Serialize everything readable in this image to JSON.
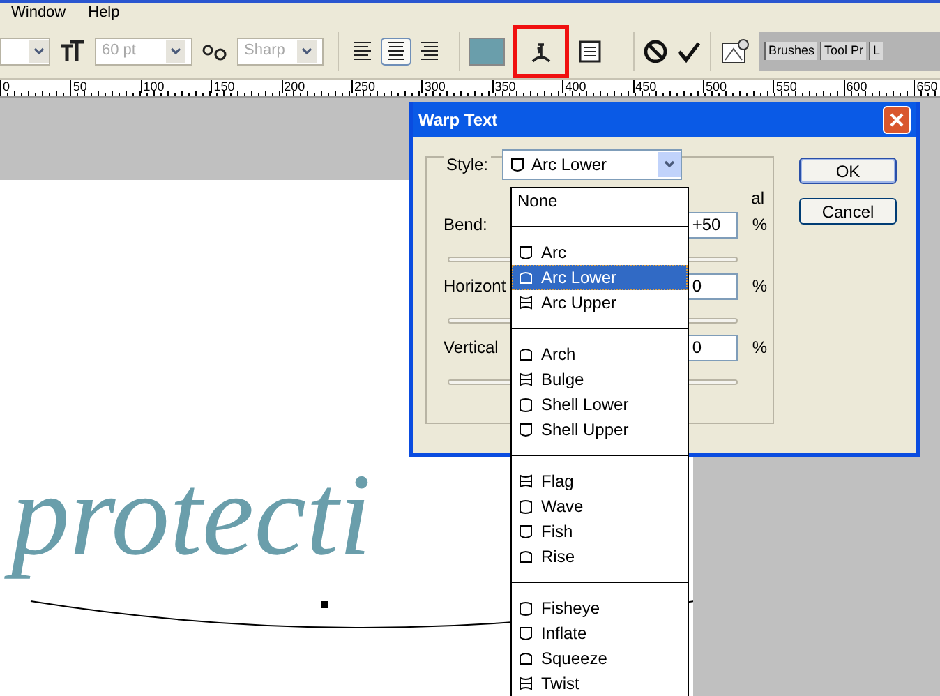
{
  "menu_bar": [
    "Window",
    "Help"
  ],
  "toolbar": {
    "font_size": {
      "value": "60 pt",
      "disabled": true
    },
    "antialias": {
      "value": "Sharp",
      "disabled": true
    },
    "align": [
      {
        "selected": false
      },
      {
        "selected": true
      },
      {
        "selected": false
      }
    ],
    "warp_highlighted": true,
    "palette_tabs": [
      "Brushes",
      "Tool Pr",
      "L"
    ]
  },
  "ruler": [
    "0",
    "50",
    "100",
    "150",
    "200",
    "250",
    "300",
    "350",
    "400",
    "450",
    "500",
    "550",
    "600",
    "650"
  ],
  "canvas_text": "protecti",
  "dialog": {
    "title": "Warp Text",
    "style_label": "Style:",
    "style_value": "Arc Lower",
    "orientation_fragment": "al",
    "fields": [
      {
        "label": "Bend:",
        "value": "+50",
        "unit": "%"
      },
      {
        "label": "Horizont",
        "value": "0",
        "unit": "%"
      },
      {
        "label": "Vertical",
        "value": "0",
        "unit": "%"
      }
    ],
    "buttons": [
      "OK",
      "Cancel"
    ]
  },
  "style_list": [
    [
      {
        "label": "None",
        "kind": "plain",
        "selected": false
      }
    ],
    [
      {
        "label": "Arc",
        "kind": "shape",
        "selected": false
      },
      {
        "label": "Arc Lower",
        "kind": "shape",
        "selected": true
      },
      {
        "label": "Arc Upper",
        "kind": "shape",
        "selected": false
      }
    ],
    [
      {
        "label": "Arch",
        "kind": "shape",
        "selected": false
      },
      {
        "label": "Bulge",
        "kind": "shape",
        "selected": false
      },
      {
        "label": "Shell Lower",
        "kind": "shape",
        "selected": false
      },
      {
        "label": "Shell Upper",
        "kind": "shape",
        "selected": false
      }
    ],
    [
      {
        "label": "Flag",
        "kind": "shape",
        "selected": false
      },
      {
        "label": "Wave",
        "kind": "shape",
        "selected": false
      },
      {
        "label": "Fish",
        "kind": "shape",
        "selected": false
      },
      {
        "label": "Rise",
        "kind": "shape",
        "selected": false
      }
    ],
    [
      {
        "label": "Fisheye",
        "kind": "shape",
        "selected": false
      },
      {
        "label": "Inflate",
        "kind": "shape",
        "selected": false
      },
      {
        "label": "Squeeze",
        "kind": "shape",
        "selected": false
      },
      {
        "label": "Twist",
        "kind": "shape",
        "selected": false
      }
    ]
  ]
}
